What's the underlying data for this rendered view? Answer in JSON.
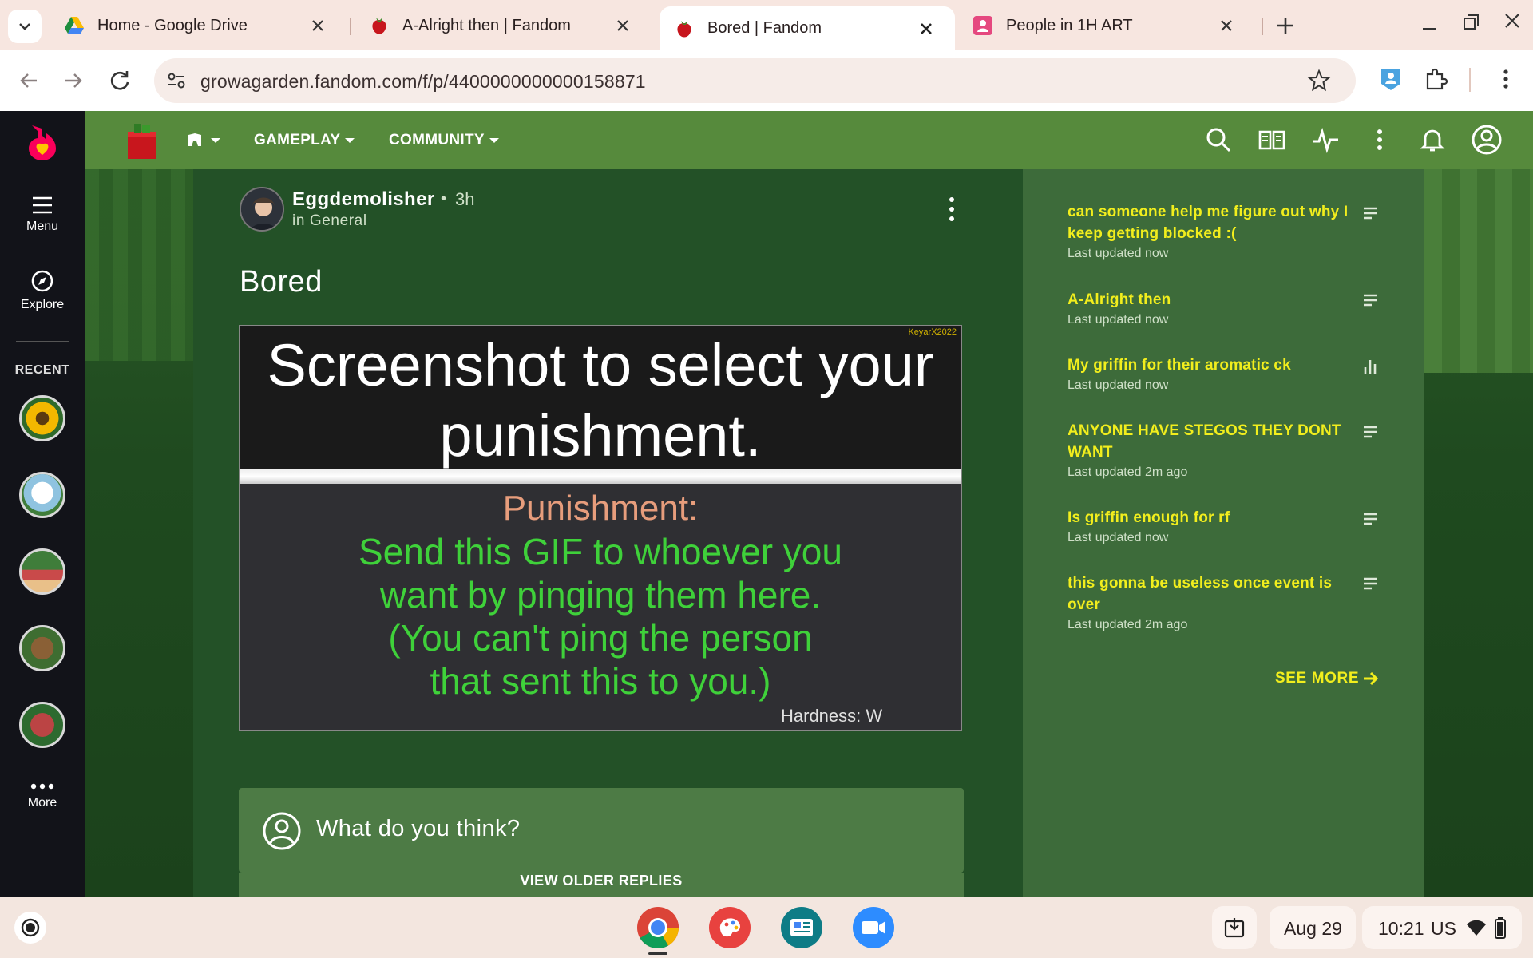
{
  "browser": {
    "tabs": [
      {
        "title": "Home - Google Drive",
        "icon": "google-drive-icon",
        "active": false
      },
      {
        "title": "A-Alright then | Fandom",
        "icon": "fandom-strawberry-icon",
        "active": false
      },
      {
        "title": "Bored | Fandom",
        "icon": "fandom-strawberry-icon",
        "active": true
      },
      {
        "title": "People in 1H ART",
        "icon": "classroom-people-icon",
        "active": false
      }
    ],
    "url": "growagarden.fandom.com/f/p/4400000000000158871"
  },
  "rail": {
    "menu_label": "Menu",
    "explore_label": "Explore",
    "recent_label": "RECENT",
    "more_label": "More",
    "recent_items": [
      "sunflower",
      "chicken",
      "picnic",
      "dog",
      "bricks"
    ]
  },
  "site_nav": {
    "gameplay_label": "GAMEPLAY",
    "community_label": "COMMUNITY"
  },
  "post": {
    "author": "Eggdemolisher",
    "separator": "•",
    "time": "3h",
    "category": "in General",
    "title": "Bored",
    "gif": {
      "headline": "Screenshot to select your punishment.",
      "watermark": "KeyarX2022",
      "punishment_label": "Punishment:",
      "punishment_text": "Send this GIF to whoever you\nwant by pinging them here.\n(You can't ping the person\nthat sent this to you.)",
      "hardness": "Hardness: W"
    },
    "comment_placeholder": "What do you think?",
    "view_older": "VIEW OLDER REPLIES"
  },
  "sidebar": {
    "items": [
      {
        "title": "can someone help me figure out why I keep getting blocked :(",
        "meta": "Last updated now",
        "icon": "text-lines-icon"
      },
      {
        "title": "A-Alright then",
        "meta": "Last updated now",
        "icon": "text-lines-icon"
      },
      {
        "title": "My griffin for their aromatic ck",
        "meta": "Last updated now",
        "icon": "poll-bars-icon"
      },
      {
        "title": "ANYONE HAVE STEGOS THEY DONT WANT",
        "meta": "Last updated 2m ago",
        "icon": "text-lines-icon"
      },
      {
        "title": "Is griffin enough for rf",
        "meta": "Last updated now",
        "icon": "text-lines-icon"
      },
      {
        "title": "this gonna be useless once event is over",
        "meta": "Last updated 2m ago",
        "icon": "text-lines-icon"
      }
    ],
    "see_more": "SEE MORE"
  },
  "shelf": {
    "date": "Aug 29",
    "time": "10:21",
    "region": "US",
    "apps": [
      "chrome-icon",
      "canvas-paint-icon",
      "news-app-icon",
      "zoom-icon"
    ]
  },
  "colors": {
    "header_green": "#568a3c",
    "content_green": "#235127",
    "sidebar_green": "#3d6b3a",
    "link_yellow": "#f2ee1d",
    "rail_dark": "#121319"
  }
}
